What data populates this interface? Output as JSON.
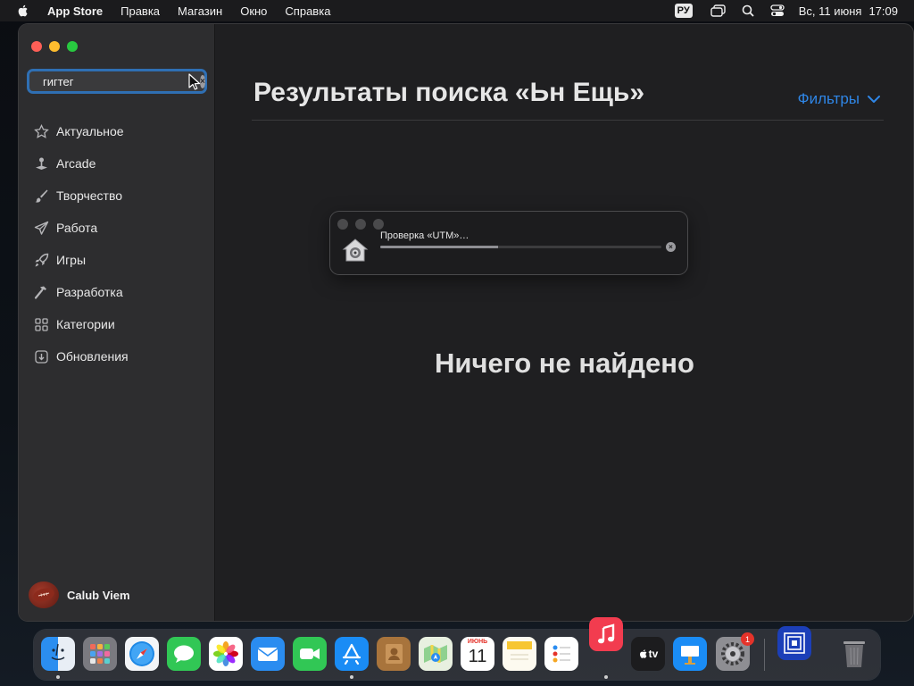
{
  "menubar": {
    "app_name": "App Store",
    "items": [
      "Правка",
      "Магазин",
      "Окно",
      "Справка"
    ],
    "input_lang": "РУ",
    "date": "Вс, 11 июня",
    "time": "17:09"
  },
  "sidebar": {
    "search": {
      "value": "гигтег"
    },
    "items": [
      {
        "label": "Актуальное",
        "icon": "star-icon"
      },
      {
        "label": "Arcade",
        "icon": "joystick-icon"
      },
      {
        "label": "Творчество",
        "icon": "brush-icon"
      },
      {
        "label": "Работа",
        "icon": "paper-plane-icon"
      },
      {
        "label": "Игры",
        "icon": "rocket-icon"
      },
      {
        "label": "Разработка",
        "icon": "hammer-icon"
      },
      {
        "label": "Категории",
        "icon": "grid-icon"
      },
      {
        "label": "Обновления",
        "icon": "download-icon"
      }
    ],
    "account": {
      "name": "Calub Viem"
    }
  },
  "main": {
    "title": "Результаты поиска «Ьн Ещь»",
    "filters_label": "Фильтры",
    "empty_message": "Ничего не найдено"
  },
  "dialog": {
    "text": "Проверка «UTM»…",
    "progress": 0.42
  },
  "dock": {
    "calendar_month": "ИЮНЬ",
    "calendar_day": "11",
    "settings_badge": "1",
    "tv_label": "tv"
  },
  "colors": {
    "accent": "#2f86e6",
    "search_focus": "#2f6fb3",
    "badge": "#e5332a"
  }
}
